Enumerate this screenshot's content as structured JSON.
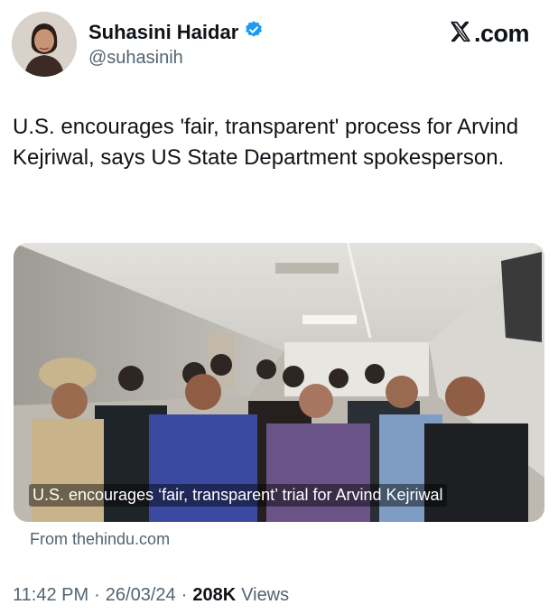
{
  "author": {
    "display_name": "Suhasini Haidar",
    "handle": "@suhasinih",
    "verified": true,
    "verified_color": "#1d9bf0"
  },
  "brand": {
    "label": ".com",
    "logo_icon": "x-logo-icon"
  },
  "tweet": {
    "text": "U.S. encourages 'fair, transparent' process for Arvind Kejriwal, says US State Department spokesperson."
  },
  "link_card": {
    "caption": "U.S. encourages ‘fair, transparent’ trial for Arvind Kejriwal",
    "source": "From thehindu.com"
  },
  "meta": {
    "time": "11:42 PM",
    "separator": "·",
    "date": "26/03/24",
    "views_count": "208K",
    "views_label": "Views"
  },
  "colors": {
    "text_primary": "#0f1419",
    "text_secondary": "#536471",
    "verified_blue": "#1d9bf0"
  }
}
